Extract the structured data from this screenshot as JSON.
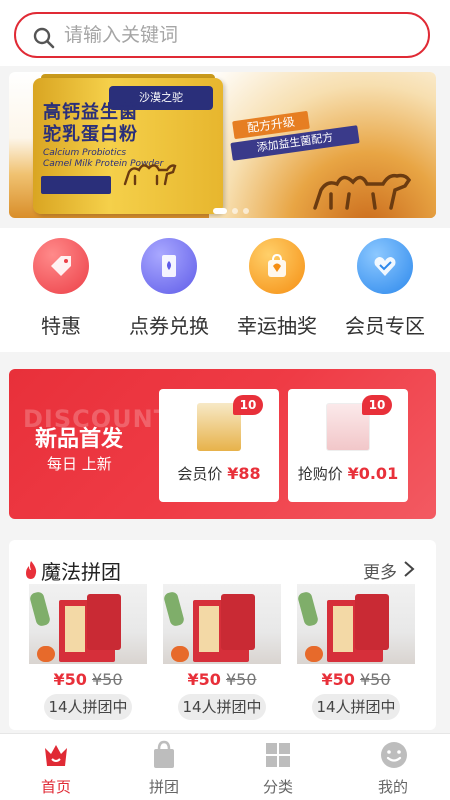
{
  "search": {
    "placeholder": "请输入关键词"
  },
  "banner": {
    "can_logo": "沙漠之驼",
    "product_name_line1": "高钙益生菌",
    "product_name_line2": "驼乳蛋白粉",
    "product_en_line1": "Calcium Probiotics",
    "product_en_line2": "Camel Milk Protein Powder",
    "badge_upgrade": "配方升级",
    "badge_added": "添加益生菌配方"
  },
  "quick_nav": [
    {
      "label": "特惠",
      "icon": "tag-icon",
      "color": "#ef4a50"
    },
    {
      "label": "点券兑换",
      "icon": "coupon-icon",
      "color": "#6f6df0"
    },
    {
      "label": "幸运抽奖",
      "icon": "gift-bag-icon",
      "color": "#f7981d"
    },
    {
      "label": "会员专区",
      "icon": "heart-hands-icon",
      "color": "#3d98f2"
    }
  ],
  "new_arrival": {
    "watermark": "DISCOUNT",
    "title": "新品首发",
    "subtitle": "每日 上新",
    "cards": [
      {
        "badge": "10",
        "price_label": "会员价",
        "currency": "¥",
        "price": "88"
      },
      {
        "badge": "10",
        "price_label": "抢购价",
        "currency": "¥",
        "price": "0.01"
      }
    ]
  },
  "group_buy": {
    "title": "魔法拼团",
    "more": "更多",
    "items": [
      {
        "price_now": "¥50",
        "price_old": "¥50",
        "count": "14人拼团中"
      },
      {
        "price_now": "¥50",
        "price_old": "¥50",
        "count": "14人拼团中"
      },
      {
        "price_now": "¥50",
        "price_old": "¥50",
        "count": "14人拼团中"
      }
    ]
  },
  "tabbar": [
    {
      "label": "首页",
      "icon": "home-crown-icon",
      "active": true
    },
    {
      "label": "拼团",
      "icon": "shopping-bag-icon",
      "active": false
    },
    {
      "label": "分类",
      "icon": "grid-icon",
      "active": false
    },
    {
      "label": "我的",
      "icon": "smiley-icon",
      "active": false
    }
  ],
  "colors": {
    "accent": "#e02a35",
    "promo_red": "#e8303a"
  }
}
